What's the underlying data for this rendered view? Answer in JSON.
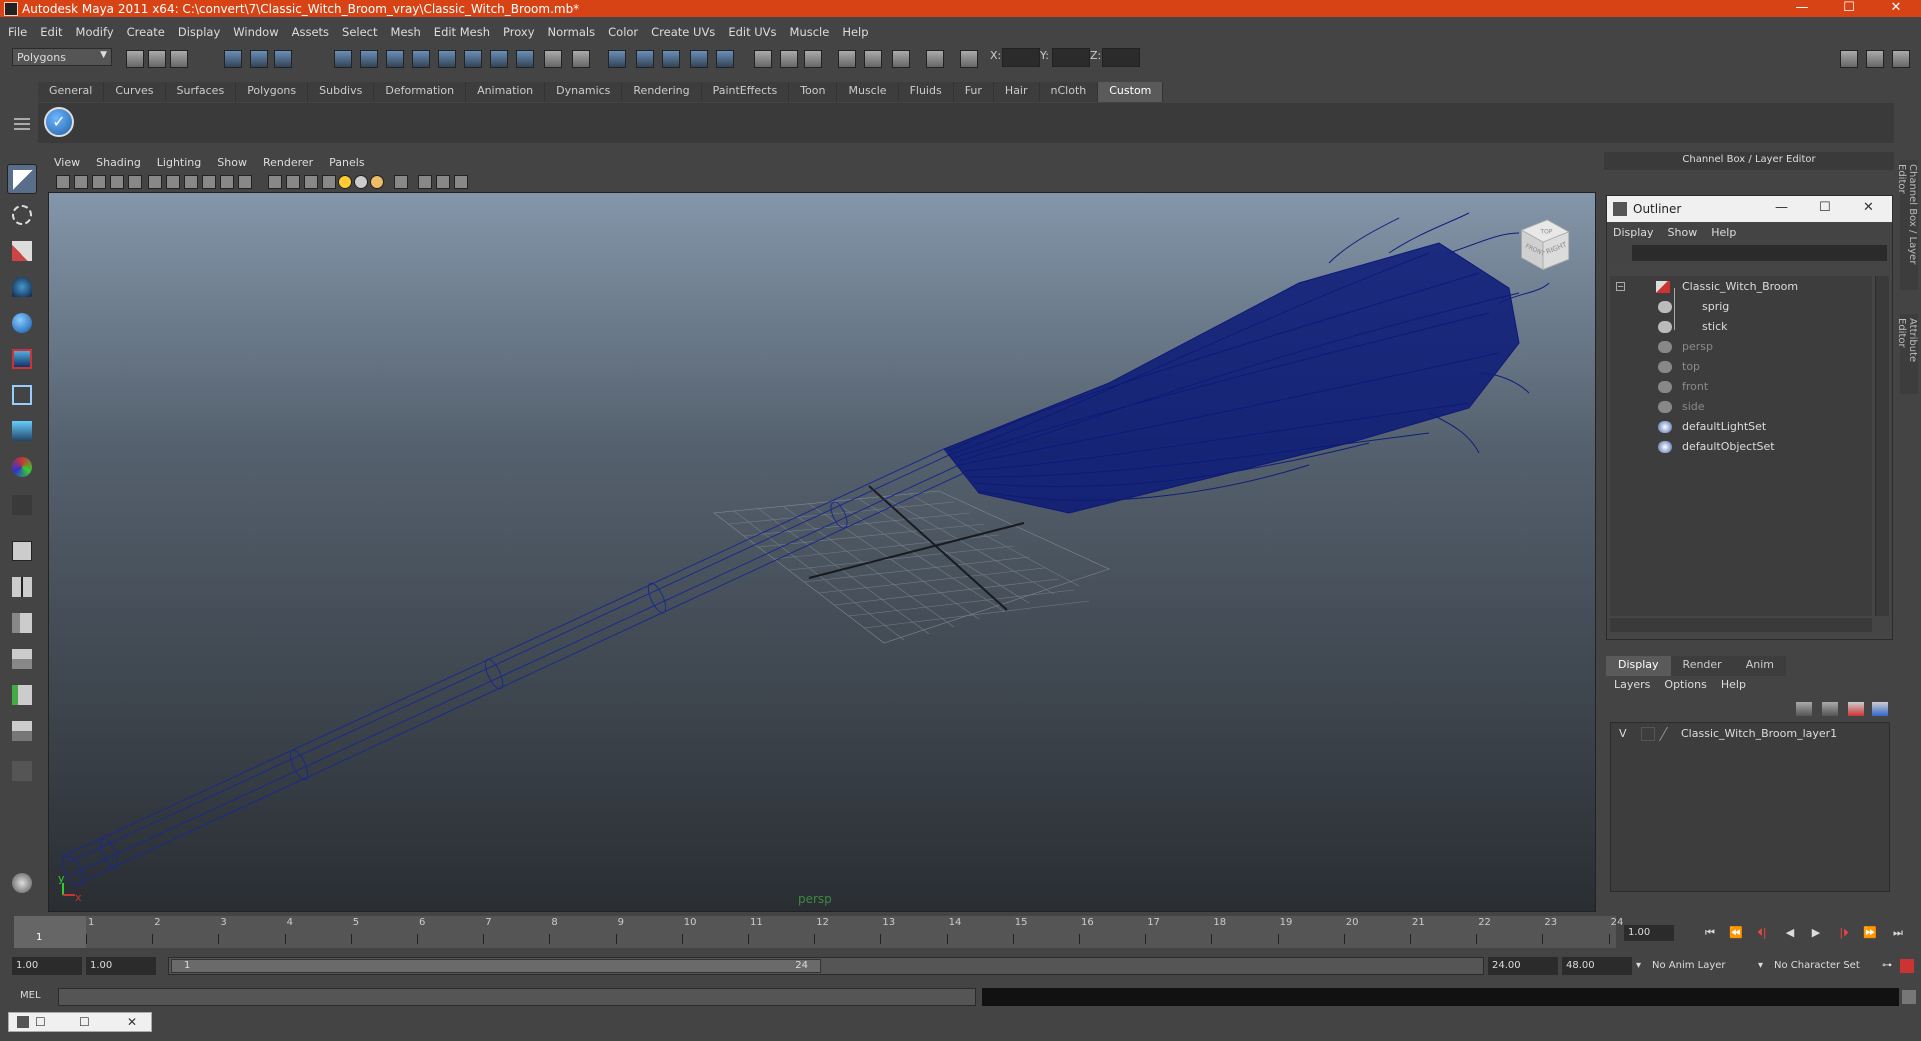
{
  "title": "Autodesk Maya 2011 x64: C:\\convert\\7\\Classic_Witch_Broom_vray\\Classic_Witch_Broom.mb*",
  "window_controls": {
    "minimize": "—",
    "maximize": "☐",
    "close": "✕"
  },
  "menubar": [
    "File",
    "Edit",
    "Modify",
    "Create",
    "Display",
    "Window",
    "Assets",
    "Select",
    "Mesh",
    "Edit Mesh",
    "Proxy",
    "Normals",
    "Color",
    "Create UVs",
    "Edit UVs",
    "Muscle",
    "Help"
  ],
  "statusline": {
    "mode": "Polygons",
    "x_label": "X:",
    "y_label": "Y:",
    "z_label": "Z:"
  },
  "shelf_tabs": [
    "General",
    "Curves",
    "Surfaces",
    "Polygons",
    "Subdivs",
    "Deformation",
    "Animation",
    "Dynamics",
    "Rendering",
    "PaintEffects",
    "Toon",
    "Muscle",
    "Fluids",
    "Fur",
    "Hair",
    "nCloth",
    "Custom"
  ],
  "shelf_active": "Custom",
  "viewport": {
    "menu": [
      "View",
      "Shading",
      "Lighting",
      "Show",
      "Renderer",
      "Panels"
    ],
    "camera_label": "persp",
    "viewcube_faces": {
      "front": "FRONT",
      "right": "RIGHT",
      "top": "TOP"
    },
    "axis": {
      "y": "y",
      "x": "x"
    }
  },
  "channelbox": {
    "header": "Channel Box / Layer Editor",
    "side_tab_1": "Channel Box / Layer Editor",
    "side_tab_2": "Attribute Editor"
  },
  "outliner": {
    "title": "Outliner",
    "menu": [
      "Display",
      "Show",
      "Help"
    ],
    "items": [
      {
        "label": "Classic_Witch_Broom",
        "kind": "group"
      },
      {
        "label": "sprig",
        "kind": "mesh"
      },
      {
        "label": "stick",
        "kind": "mesh"
      },
      {
        "label": "persp",
        "kind": "camera"
      },
      {
        "label": "top",
        "kind": "camera"
      },
      {
        "label": "front",
        "kind": "camera"
      },
      {
        "label": "side",
        "kind": "camera"
      },
      {
        "label": "defaultLightSet",
        "kind": "set"
      },
      {
        "label": "defaultObjectSet",
        "kind": "set"
      }
    ]
  },
  "layer_editor": {
    "tabs": [
      "Display",
      "Render",
      "Anim"
    ],
    "active_tab": "Display",
    "menu": [
      "Layers",
      "Options",
      "Help"
    ],
    "layers": [
      {
        "visibility": "V",
        "name": "Classic_Witch_Broom_layer1"
      }
    ]
  },
  "timeslider": {
    "ticks": [
      "1",
      "2",
      "3",
      "4",
      "5",
      "6",
      "7",
      "8",
      "9",
      "10",
      "11",
      "12",
      "13",
      "14",
      "15",
      "16",
      "17",
      "18",
      "19",
      "20",
      "21",
      "22",
      "23",
      "24"
    ],
    "current_frame_marker": "1",
    "current_time": "1.00",
    "playback_buttons": [
      "⏮",
      "⏪",
      "⏴|",
      "◀",
      "▶",
      "|⏵",
      "⏩",
      "⏭"
    ]
  },
  "range": {
    "start": "1.00",
    "anim_start": "1.00",
    "thumb_start": "1",
    "thumb_end": "24",
    "end": "24.00",
    "anim_end": "48.00",
    "anim_layer": "No Anim Layer",
    "character_set": "No Character Set"
  },
  "cmdline": {
    "label": "MEL"
  }
}
